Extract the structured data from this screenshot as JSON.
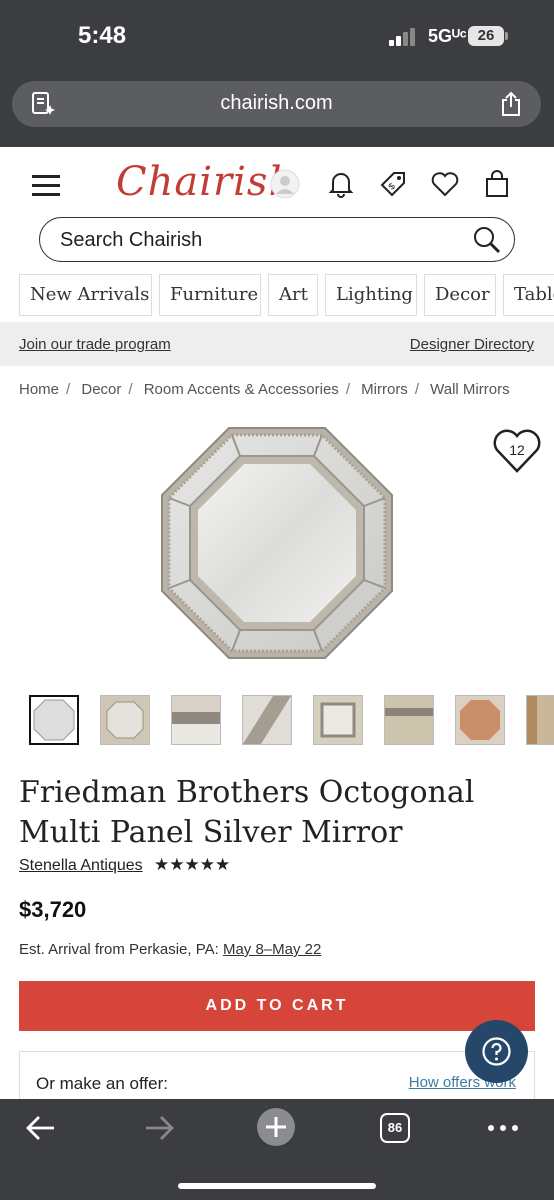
{
  "status_bar": {
    "time": "5:48",
    "network": "5Gᵁᶜ",
    "battery": "26"
  },
  "browser": {
    "url": "chairish.com",
    "tabs_count": "86"
  },
  "header": {
    "logo": "Chairish",
    "search_placeholder": "Search Chairish",
    "nav": [
      "New Arrivals",
      "Furniture",
      "Art",
      "Lighting",
      "Decor",
      "Table"
    ]
  },
  "trade_bar": {
    "trade_link": "Join our trade program",
    "designer_link": "Designer Directory"
  },
  "breadcrumb": [
    "Home",
    "Decor",
    "Room Accents & Accessories",
    "Mirrors",
    "Wall Mirrors"
  ],
  "product": {
    "favorites": "12",
    "title": "Friedman Brothers Octogonal Multi Panel Silver Mirror",
    "seller": "Stenella Antiques",
    "rating_stars": "★★★★★",
    "price": "$3,720",
    "arrival_prefix": "Est. Arrival from Perkasie, PA:",
    "arrival_dates": "May 8–May 22",
    "add_to_cart": "ADD TO CART",
    "offer_label": "Or make an offer:",
    "offer_link": "How offers work"
  },
  "colors": {
    "brand": "#c33c35",
    "cta": "#d5453a",
    "help": "#24476a",
    "browser_chrome": "#3b3d40"
  },
  "icons": [
    "reader-icon",
    "share-icon",
    "menu-icon",
    "account-icon",
    "bell-icon",
    "tag-icon",
    "heart-icon",
    "cart-icon",
    "search-icon",
    "help-icon",
    "back-icon",
    "forward-icon",
    "new-tab-icon",
    "more-icon"
  ]
}
